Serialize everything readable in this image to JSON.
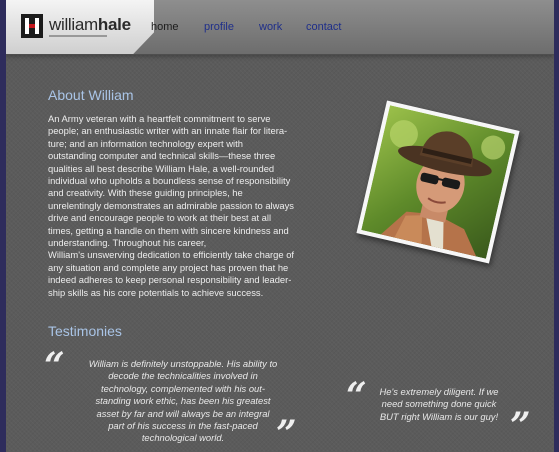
{
  "brand": {
    "name_light": "william",
    "name_bold": "hale"
  },
  "nav": {
    "items": [
      {
        "label": "home",
        "active": true
      },
      {
        "label": "profile",
        "active": false
      },
      {
        "label": "work",
        "active": false
      },
      {
        "label": "contact",
        "active": false
      }
    ]
  },
  "about": {
    "heading": "About William",
    "body": "An Army veteran with a heartfelt commitment to serve\npeople; an enthusiastic writer with an innate flair for litera-\nture; and an information technology expert with\noutstanding computer and technical skills—these three\nqualities all best describe William Hale, a well-rounded\nindividual who upholds a boundless sense of responsibility\nand creativity. With these guiding principles, he\nunrelentingly demonstrates an admirable passion to always\ndrive and encourage people to work at their best at all\ntimes, getting a handle on them with sincere kindness and\nunderstanding. Throughout his career,\nWilliam's unswerving dedication to efficiently take charge of\nany situation and complete any project has proven that he\nindeed adheres to keep personal responsibility and leader-\nship skills as his core potentials to achieve success."
  },
  "testimonies": {
    "heading": "Testimonies",
    "items": [
      {
        "text": "William is definitely unstoppable. His ability to\ndecode the technicalities involved in\ntechnology, complemented with his out-\nstanding work ethic, has been his greatest\nasset by far and will always be an integral\npart of his success in the fast-paced\ntechnological world."
      },
      {
        "text": "He's extremely diligent. If we\nneed something done quick\nBUT right William is our guy!"
      }
    ],
    "open_quote": "“",
    "close_quote": "”"
  },
  "colors": {
    "heading": "#a9c4e6",
    "nav_link": "#1f2f8a",
    "logo_red": "#c4161c"
  }
}
